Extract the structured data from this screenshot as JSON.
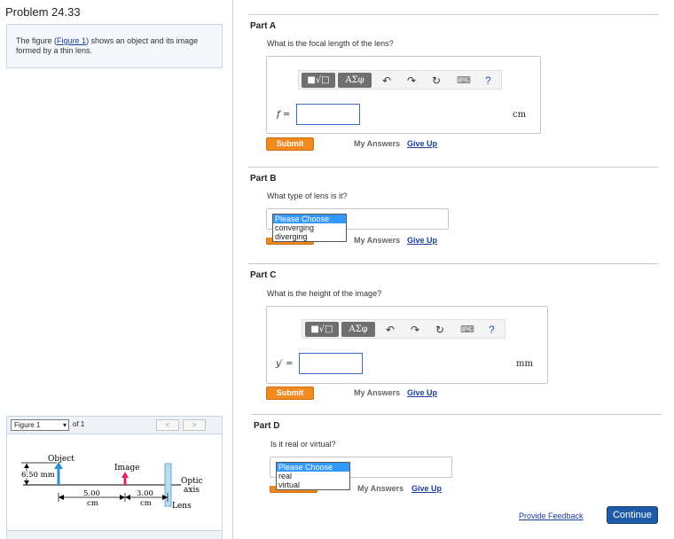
{
  "problem": {
    "title": "Problem 24.33",
    "intro_pre": "The figure (",
    "intro_link": "Figure 1",
    "intro_post": ") shows an object and its image formed by a thin lens."
  },
  "figure_panel": {
    "selected": "Figure 1",
    "of_label": "of 1",
    "prev": "<",
    "next": ">",
    "labels": {
      "object": "Object",
      "image": "Image",
      "height": "6.50 mm",
      "optic": "Optic",
      "axis": "axis",
      "lens": "Lens",
      "d1_value": "5.00",
      "d1_unit": "cm",
      "d2_value": "3.00",
      "d2_unit": "cm"
    }
  },
  "toolbar": {
    "templates": "■√□",
    "greek": "ΑΣφ",
    "undo": "↶",
    "redo": "↷",
    "reset": "↻",
    "keyboard": "⌨",
    "help": "?"
  },
  "parts": {
    "a": {
      "title": "Part A",
      "question": "What is the focal length of the lens?",
      "var": "f =",
      "value": "",
      "unit": "cm",
      "submit": "Submit",
      "my_answers": "My Answers",
      "give_up": "Give Up"
    },
    "b": {
      "title": "Part B",
      "question": "What type of lens is it?",
      "options": [
        "Please Choose",
        "converging",
        "diverging"
      ],
      "my_answers": "My Answers",
      "give_up": "Give Up"
    },
    "c": {
      "title": "Part C",
      "question": "What is the height of the image?",
      "var": "y′ =",
      "value": "",
      "unit": "mm",
      "submit": "Submit",
      "my_answers": "My Answers",
      "give_up": "Give Up"
    },
    "d": {
      "title": "Part D",
      "question": "Is it real or virtual?",
      "options": [
        "Please Choose",
        "real",
        "virtual"
      ],
      "my_answers": "My Answers",
      "give_up": "Give Up"
    }
  },
  "footer": {
    "feedback": "Provide Feedback",
    "continue": "Continue"
  }
}
